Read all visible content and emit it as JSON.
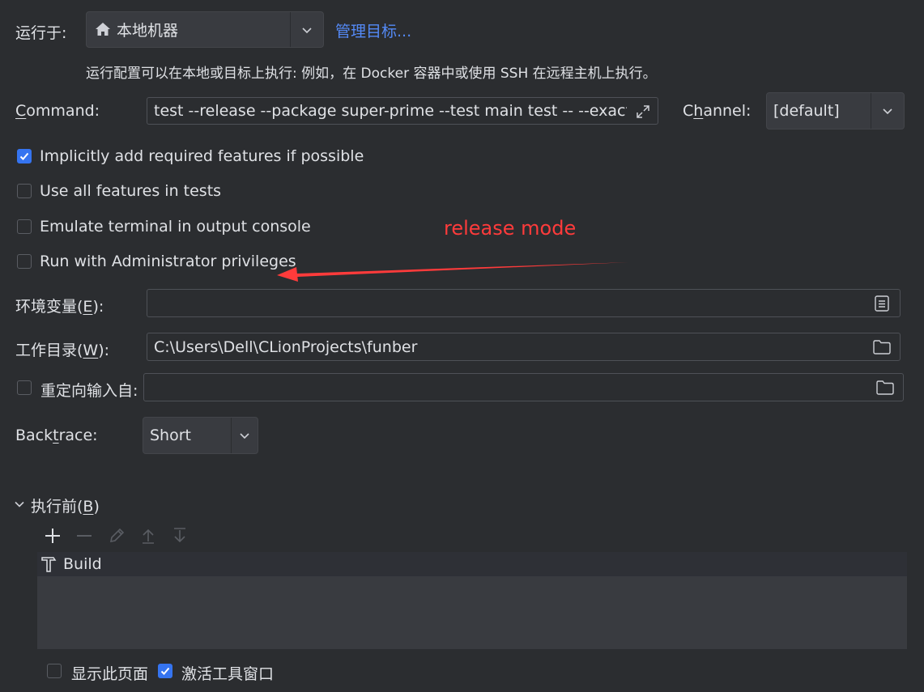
{
  "run_on": {
    "label": "运行于:",
    "target_value": "本地机器",
    "manage_link": "管理目标...",
    "hint": "运行配置可以在本地或目标上执行: 例如，在 Docker 容器中或使用 SSH 在远程主机上执行。"
  },
  "command": {
    "label_prefix": "",
    "label_ul": "C",
    "label_rest": "ommand:",
    "value": "test --release --package super-prime --test main test -- --exact"
  },
  "channel": {
    "label_prefix": "C",
    "label_ul": "h",
    "label_rest": "annel:",
    "value": "[default]"
  },
  "options": [
    {
      "label": "Implicitly add required features if possible",
      "checked": true
    },
    {
      "label": "Use all features in tests",
      "checked": false
    },
    {
      "label": "Emulate terminal in output console",
      "checked": false
    },
    {
      "label": "Run with Administrator privileges",
      "checked": false
    }
  ],
  "annotation": {
    "text": "release mode",
    "color": "#ff3b3b"
  },
  "env": {
    "label_prefix": "环境变量(",
    "label_ul": "E",
    "label_rest": "):",
    "value": ""
  },
  "workdir": {
    "label_prefix": "工作目录(",
    "label_ul": "W",
    "label_rest": "):",
    "value": "C:\\Users\\Dell\\CLionProjects\\funber"
  },
  "redirect": {
    "label": "重定向输入自:",
    "checked": false,
    "value": ""
  },
  "backtrace": {
    "label_prefix": "Back",
    "label_ul": "t",
    "label_rest": "race:",
    "value": "Short"
  },
  "before_launch": {
    "label_prefix": "执行前(",
    "label_ul": "B",
    "label_rest": ")",
    "tasks": [
      {
        "label": "Build"
      }
    ],
    "tools": [
      "plus-icon",
      "minus-icon",
      "pencil-icon",
      "move-up-icon",
      "move-down-icon"
    ]
  },
  "footer": {
    "show_page": {
      "label": "显示此页面",
      "checked": false
    },
    "activate_tool": {
      "label": "激活工具窗口",
      "checked": true
    }
  },
  "colors": {
    "background": "#2b2d30",
    "accent": "#3574f0",
    "link": "#548af7"
  }
}
